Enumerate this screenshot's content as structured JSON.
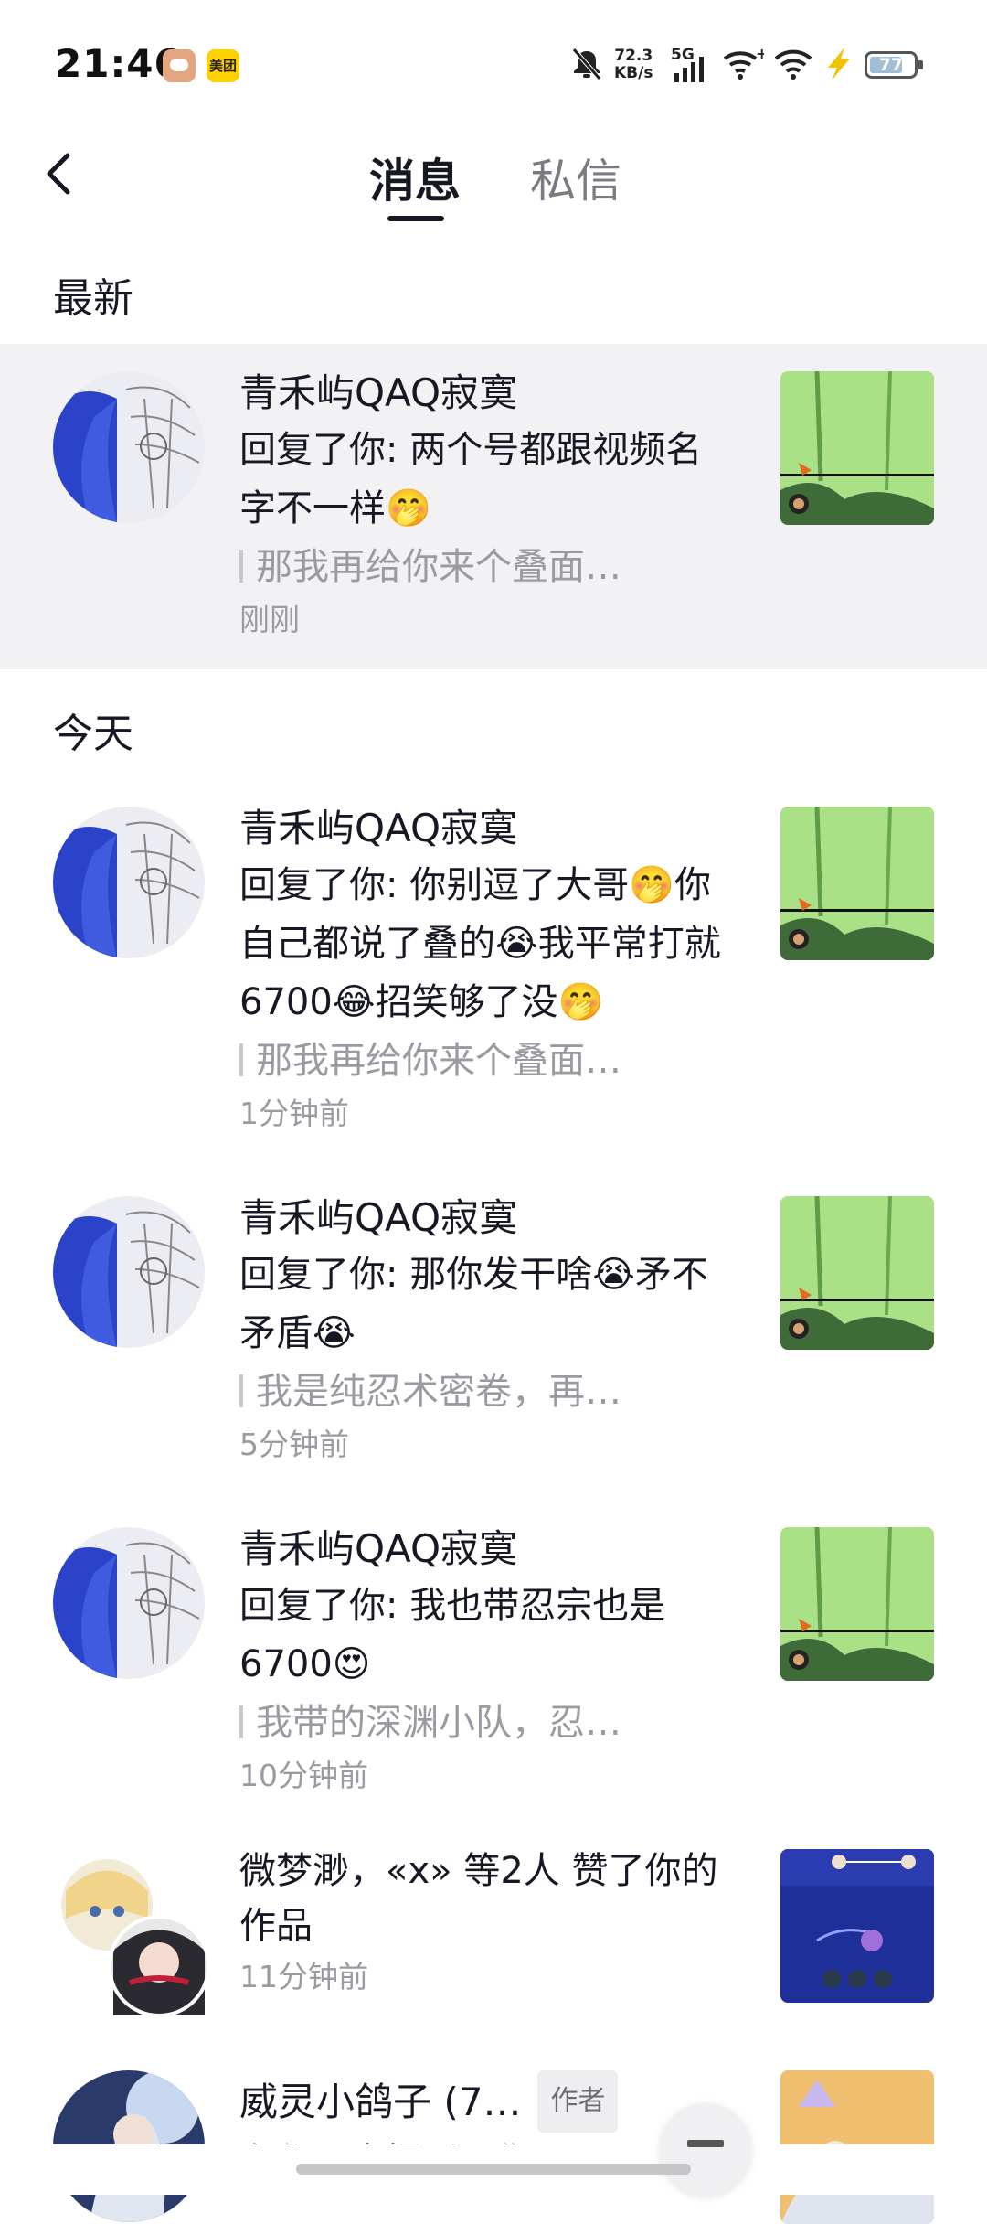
{
  "status": {
    "time": "21:46",
    "net_speed_value": "72.3",
    "net_speed_unit": "KB/s",
    "network": "5G",
    "battery": "77",
    "meituan_label": "美团",
    "icons": [
      "chat-app-icon",
      "meituan-icon",
      "mute-icon",
      "signal-icon",
      "wifi-plus-icon",
      "wifi-icon",
      "charging-icon",
      "battery-icon"
    ]
  },
  "header": {
    "tabs": [
      {
        "label": "消息",
        "active": true
      },
      {
        "label": "私信",
        "active": false
      }
    ]
  },
  "sections": {
    "latest": "最新",
    "today": "今天"
  },
  "items": [
    {
      "name": "青禾屿QAQ寂寞",
      "content": "回复了你: 两个号都跟视频名字不一样🤭",
      "quote": "那我再给你来个叠面…",
      "time": "刚刚"
    },
    {
      "name": "青禾屿QAQ寂寞",
      "content": "回复了你: 你别逗了大哥🤭你自己都说了叠的😭我平常打就6700😂招笑够了没🤭",
      "quote": "那我再给你来个叠面…",
      "time": "1分钟前"
    },
    {
      "name": "青禾屿QAQ寂寞",
      "content": "回复了你: 那你发干啥😭矛不矛盾😭",
      "quote": "我是纯忍术密卷，再…",
      "time": "5分钟前"
    },
    {
      "name": "青禾屿QAQ寂寞",
      "content": "回复了你: 我也带忍宗也是6700😍",
      "quote": "我带的深渊小队，忍…",
      "time": "10分钟前"
    },
    {
      "name": "微梦渺，«x» 等2人 赞了你的作品",
      "time": "11分钟前"
    },
    {
      "name": "威灵小鸽子 (7…",
      "tag": "作者",
      "content": "在作品中提到了你"
    }
  ],
  "colors": {
    "highlight_bg": "#f2f2f4",
    "primary_text": "#161823",
    "secondary_text": "#9a9ba1"
  }
}
